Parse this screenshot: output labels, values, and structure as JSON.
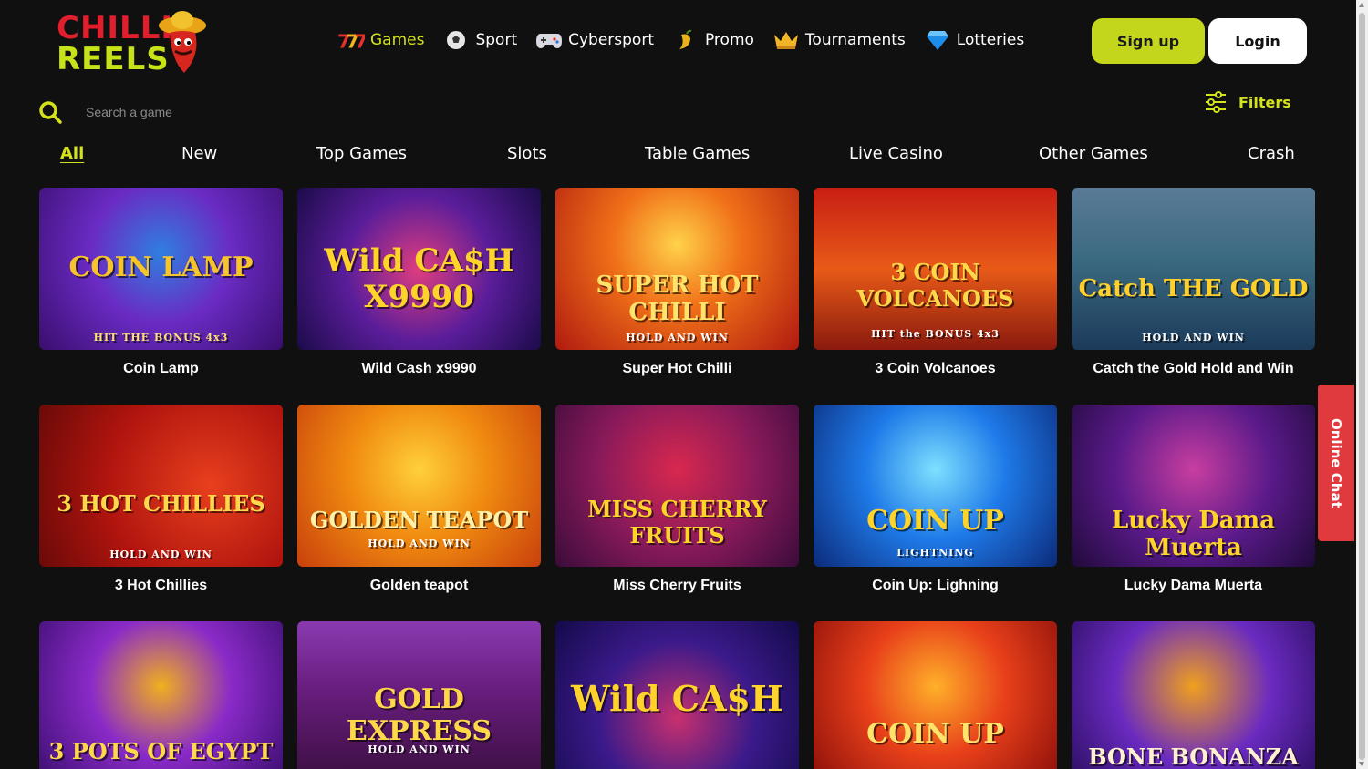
{
  "brand": {
    "logo_line1": "CHILLI",
    "logo_line2": "REELS"
  },
  "nav": [
    {
      "label": "Games",
      "icon": "slot-777-icon",
      "active": true
    },
    {
      "label": "Sport",
      "icon": "soccer-ball-icon"
    },
    {
      "label": "Cybersport",
      "icon": "gamepad-icon"
    },
    {
      "label": "Promo",
      "icon": "pepper-icon"
    },
    {
      "label": "Tournaments",
      "icon": "crown-icon"
    },
    {
      "label": "Lotteries",
      "icon": "diamond-icon"
    }
  ],
  "auth": {
    "signup_label": "Sign up",
    "login_label": "Login"
  },
  "search": {
    "placeholder": "Search a game"
  },
  "filters": {
    "label": "Filters"
  },
  "tabs": [
    "All",
    "New",
    "Top Games",
    "Slots",
    "Table Games",
    "Live Casino",
    "Other Games",
    "Crash"
  ],
  "games": [
    {
      "name": "Coin Lamp",
      "art_title": "COIN LAMP",
      "art_sub": "HIT THE BONUS 4x3"
    },
    {
      "name": "Wild Cash x9990",
      "art_title": "Wild CA$H X9990",
      "art_sub": ""
    },
    {
      "name": "Super Hot Chilli",
      "art_title": "SUPER HOT CHILLI",
      "art_sub": "HOLD AND WIN"
    },
    {
      "name": "3 Coin Volcanoes",
      "art_title": "3 COIN VOLCANOES",
      "art_sub": "HIT the BONUS 4x3"
    },
    {
      "name": "Catch the Gold Hold and Win",
      "art_title": "Catch THE GOLD",
      "art_sub": "HOLD AND WIN"
    },
    {
      "name": "3 Hot Chillies",
      "art_title": "3 HOT CHILLIES",
      "art_sub": "HOLD AND WIN"
    },
    {
      "name": "Golden teapot",
      "art_title": "GOLDEN TEAPOT",
      "art_sub": "HOLD AND WIN"
    },
    {
      "name": "Miss Cherry Fruits",
      "art_title": "MISS CHERRY FRUITS",
      "art_sub": ""
    },
    {
      "name": "Coin Up: Lighning",
      "art_title": "COIN UP",
      "art_sub": "LIGHTNING"
    },
    {
      "name": "Lucky Dama Muerta",
      "art_title": "Lucky Dama Muerta",
      "art_sub": ""
    },
    {
      "name": "",
      "art_title": "3 POTS OF EGYPT",
      "art_sub": ""
    },
    {
      "name": "",
      "art_title": "GOLD EXPRESS",
      "art_sub": "HOLD AND WIN"
    },
    {
      "name": "",
      "art_title": "Wild CA$H",
      "art_sub": ""
    },
    {
      "name": "",
      "art_title": "COIN UP",
      "art_sub": ""
    },
    {
      "name": "",
      "art_title": "BONE BONANZA",
      "art_sub": ""
    }
  ],
  "online_chat": {
    "label": "Online Chat"
  },
  "colors": {
    "accent": "#d4e21c",
    "background": "#101010",
    "chat": "#e0393e"
  }
}
